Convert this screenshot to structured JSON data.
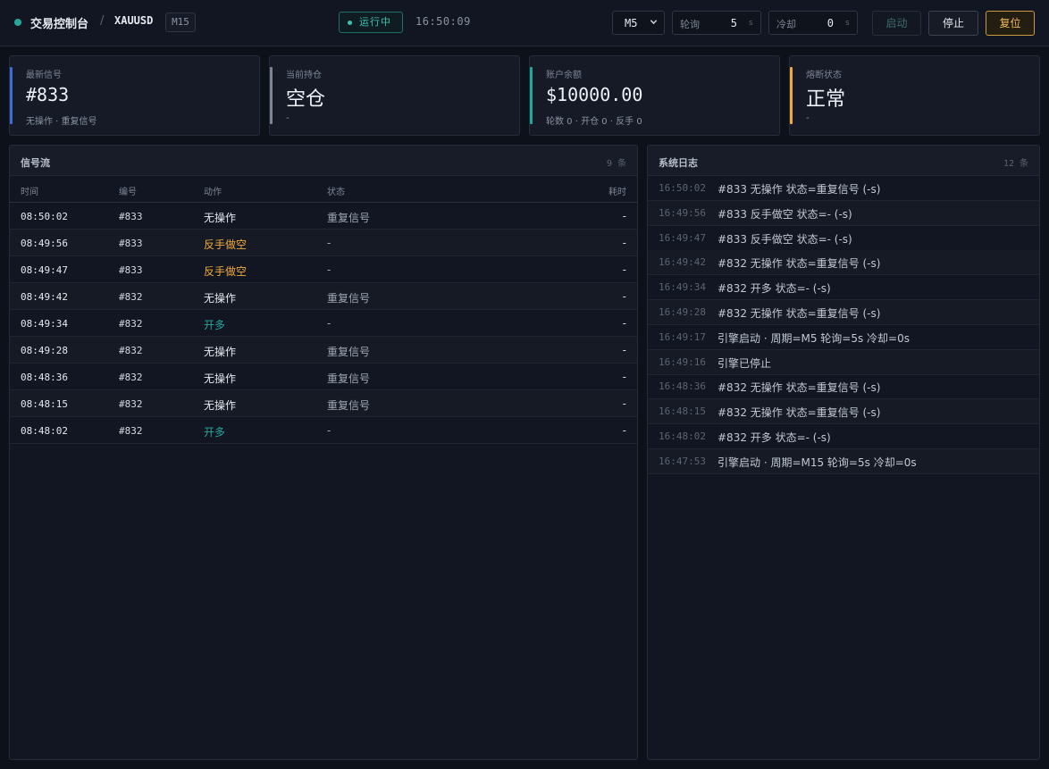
{
  "header": {
    "title": "交易控制台",
    "separator": "/",
    "symbol": "XAUUSD",
    "timeframe_badge": "M15",
    "status": "运行中",
    "clock": "16:50:09",
    "timeframe_select": "M5",
    "poll": {
      "label": "轮询",
      "value": "5",
      "unit": "s"
    },
    "cooldown": {
      "label": "冷却",
      "value": "0",
      "unit": "s"
    },
    "buttons": {
      "start": "启动",
      "stop": "停止",
      "reset": "复位"
    }
  },
  "colors": {
    "accent_teal": "#26a69a",
    "accent_orange": "#f2a93b",
    "accent_blue": "#3d6bd8",
    "accent_gray": "#7d8595"
  },
  "cards": [
    {
      "label": "最新信号",
      "value": "#833",
      "sub": "无操作 · 重复信号",
      "accent": "#3d6bd8"
    },
    {
      "label": "当前持仓",
      "value": "空仓",
      "sub": "-",
      "accent": "#7d8595"
    },
    {
      "label": "账户余额",
      "value": "$10000.00",
      "sub": "轮数 0 · 开仓 0 · 反手 0",
      "accent": "#26a69a"
    },
    {
      "label": "熔断状态",
      "value": "正常",
      "sub": "-",
      "accent": "#f2a93b"
    }
  ],
  "signals": {
    "title": "信号流",
    "count": "9 条",
    "columns": {
      "time": "时间",
      "num": "编号",
      "action": "动作",
      "state": "状态",
      "elapsed": "耗时"
    },
    "rows": [
      {
        "time": "08:50:02",
        "num": "#833",
        "action": "无操作",
        "action_color": "#e6e9ef",
        "state": "重复信号",
        "elapsed": "-"
      },
      {
        "time": "08:49:56",
        "num": "#833",
        "action": "反手做空",
        "action_color": "#f2a93b",
        "state": "-",
        "elapsed": "-"
      },
      {
        "time": "08:49:47",
        "num": "#833",
        "action": "反手做空",
        "action_color": "#f2a93b",
        "state": "-",
        "elapsed": "-"
      },
      {
        "time": "08:49:42",
        "num": "#832",
        "action": "无操作",
        "action_color": "#e6e9ef",
        "state": "重复信号",
        "elapsed": "-"
      },
      {
        "time": "08:49:34",
        "num": "#832",
        "action": "开多",
        "action_color": "#26a69a",
        "state": "-",
        "elapsed": "-"
      },
      {
        "time": "08:49:28",
        "num": "#832",
        "action": "无操作",
        "action_color": "#e6e9ef",
        "state": "重复信号",
        "elapsed": "-"
      },
      {
        "time": "08:48:36",
        "num": "#832",
        "action": "无操作",
        "action_color": "#e6e9ef",
        "state": "重复信号",
        "elapsed": "-"
      },
      {
        "time": "08:48:15",
        "num": "#832",
        "action": "无操作",
        "action_color": "#e6e9ef",
        "state": "重复信号",
        "elapsed": "-"
      },
      {
        "time": "08:48:02",
        "num": "#832",
        "action": "开多",
        "action_color": "#26a69a",
        "state": "-",
        "elapsed": "-"
      }
    ]
  },
  "logs": {
    "title": "系统日志",
    "count": "12 条",
    "rows": [
      {
        "time": "16:50:02",
        "msg": "#833 无操作 状态=重复信号 (-s)"
      },
      {
        "time": "16:49:56",
        "msg": "#833 反手做空 状态=- (-s)"
      },
      {
        "time": "16:49:47",
        "msg": "#833 反手做空 状态=- (-s)"
      },
      {
        "time": "16:49:42",
        "msg": "#832 无操作 状态=重复信号 (-s)"
      },
      {
        "time": "16:49:34",
        "msg": "#832 开多 状态=- (-s)"
      },
      {
        "time": "16:49:28",
        "msg": "#832 无操作 状态=重复信号 (-s)"
      },
      {
        "time": "16:49:17",
        "msg": "引擎启动 · 周期=M5 轮询=5s 冷却=0s"
      },
      {
        "time": "16:49:16",
        "msg": "引擎已停止"
      },
      {
        "time": "16:48:36",
        "msg": "#832 无操作 状态=重复信号 (-s)"
      },
      {
        "time": "16:48:15",
        "msg": "#832 无操作 状态=重复信号 (-s)"
      },
      {
        "time": "16:48:02",
        "msg": "#832 开多 状态=- (-s)"
      },
      {
        "time": "16:47:53",
        "msg": "引擎启动 · 周期=M15 轮询=5s 冷却=0s"
      }
    ]
  }
}
